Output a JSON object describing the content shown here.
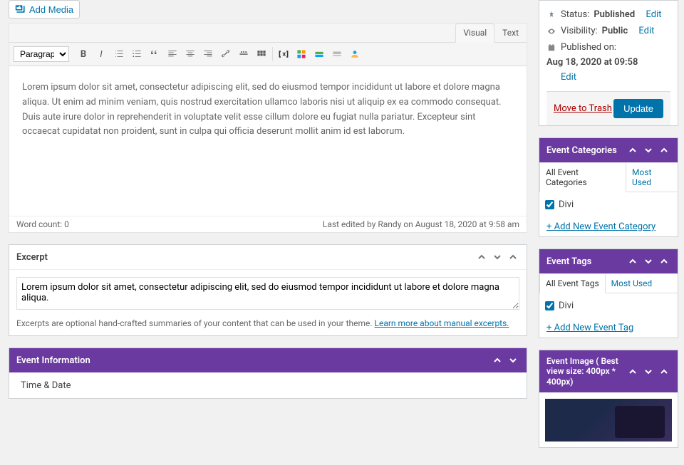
{
  "addMedia": "Add Media",
  "editorTabs": {
    "visual": "Visual",
    "text": "Text"
  },
  "toolbar": {
    "formatSel": "Paragraph"
  },
  "content": "Lorem ipsum dolor sit amet, consectetur adipiscing elit, sed do eiusmod tempor incididunt ut labore et dolore magna aliqua. Ut enim ad minim veniam, quis nostrud exercitation ullamco laboris nisi ut aliquip ex ea commodo consequat. Duis aute irure dolor in reprehenderit in voluptate velit esse cillum dolore eu fugiat nulla pariatur. Excepteur sint occaecat cupidatat non proident, sunt in culpa qui officia deserunt mollit anim id est laborum.",
  "statusBar": {
    "wordCount": "Word count: 0",
    "lastEdited": "Last edited by Randy on August 18, 2020 at 9:58 am"
  },
  "excerpt": {
    "title": "Excerpt",
    "value": "Lorem ipsum dolor sit amet, consectetur adipiscing elit, sed do eiusmod tempor incididunt ut labore et dolore magna aliqua.",
    "help": "Excerpts are optional hand-crafted summaries of your content that can be used in your theme. ",
    "helpLink": "Learn more about manual excerpts."
  },
  "eventInfo": {
    "title": "Event Information",
    "timeDate": "Time & Date"
  },
  "publish": {
    "statusLabel": "Status: ",
    "statusValue": "Published",
    "statusEdit": "Edit",
    "visLabel": "Visibility: ",
    "visValue": "Public",
    "visEdit": "Edit",
    "pubLabel": "Published on: ",
    "pubValue": "Aug 18, 2020 at 09:58",
    "pubEdit": "Edit",
    "trash": "Move to Trash",
    "update": "Update"
  },
  "eventCats": {
    "title": "Event Categories",
    "tabAll": "All Event Categories",
    "tabMost": "Most Used",
    "item": "Divi",
    "add": "+ Add New Event Category"
  },
  "eventTags": {
    "title": "Event Tags",
    "tabAll": "All Event Tags",
    "tabMost": "Most Used",
    "item": "Divi",
    "add": "+ Add New Event Tag"
  },
  "eventImage": {
    "title": "Event Image ( Best view size: 400px * 400px)"
  }
}
